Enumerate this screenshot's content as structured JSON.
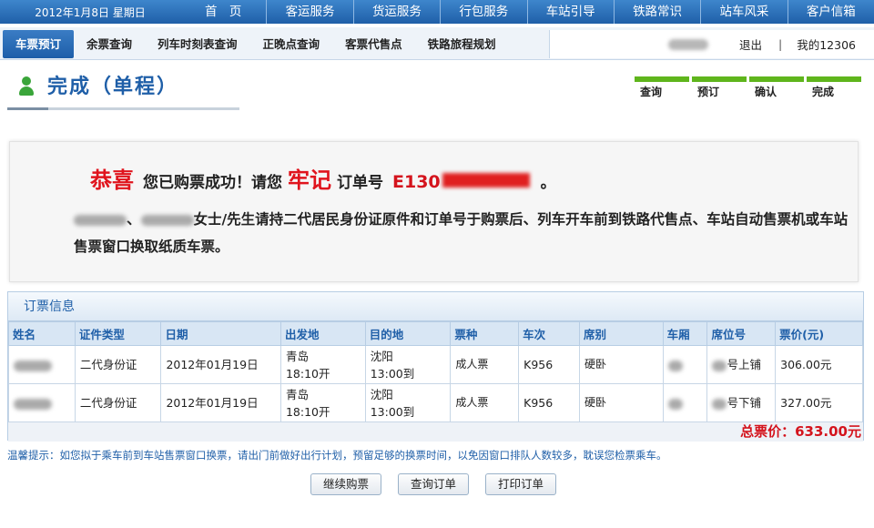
{
  "topbar": {
    "date": "2012年1月8日 星期日",
    "nav": [
      "首　页",
      "客运服务",
      "货运服务",
      "行包服务",
      "车站引导",
      "铁路常识",
      "站车风采",
      "客户信箱"
    ]
  },
  "subnav": {
    "tabs": [
      "车票预订",
      "余票查询",
      "列车时刻表查询",
      "正晚点查询",
      "客票代售点",
      "铁路旅程规划"
    ],
    "logout": "退出",
    "separator": "|",
    "my_account": "我的12306"
  },
  "page_title": "完成（单程）",
  "steps": [
    "查询",
    "预订",
    "确认",
    "完成"
  ],
  "success": {
    "congrats": "恭喜",
    "message": "您已购票成功！请您",
    "remember": "牢记",
    "order_label": "订单号",
    "order_prefix": "E130",
    "period": "。",
    "notice_sep": "、",
    "notice_text": "女士/先生请持二代居民身份证原件和订单号于购票后、列车开车前到铁路代售点、车站自动售票机或车站售票窗口换取纸质车票。"
  },
  "order_info": {
    "header": "订票信息",
    "columns": [
      "姓名",
      "证件类型",
      "日期",
      "出发地",
      "目的地",
      "票种",
      "车次",
      "席别",
      "车厢",
      "席位号",
      "票价(元)"
    ],
    "rows": [
      {
        "id_type": "二代身份证",
        "date": "2012年01月19日",
        "from_city": "青岛",
        "from_time": "18:10开",
        "to_city": "沈阳",
        "to_time": "13:00到",
        "ticket_type": "成人票",
        "train": "K956",
        "seat_class": "硬卧",
        "seat_no": "号上铺",
        "price": "306.00元"
      },
      {
        "id_type": "二代身份证",
        "date": "2012年01月19日",
        "from_city": "青岛",
        "from_time": "18:10开",
        "to_city": "沈阳",
        "to_time": "13:00到",
        "ticket_type": "成人票",
        "train": "K956",
        "seat_class": "硬卧",
        "seat_no": "号下铺",
        "price": "327.00元"
      }
    ],
    "total": "总票价：633.00元"
  },
  "tip": "温馨提示：如您拟于乘车前到车站售票窗口换票，请出门前做好出行计划，预留足够的换票时间，以免因窗口排队人数较多，耽误您检票乘车。",
  "buttons": {
    "continue": "继续购票",
    "query": "查询订单",
    "print": "打印订单"
  },
  "colors": {
    "brand_blue": "#1f5fa8",
    "alert_red": "#e0141d",
    "step_green": "#5fb51c"
  }
}
